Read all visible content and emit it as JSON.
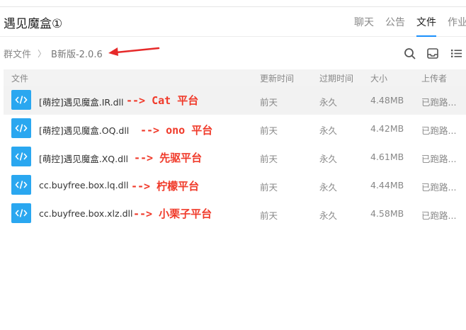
{
  "header": {
    "group_title": "遇见魔盒①",
    "tabs": [
      {
        "label": "聊天"
      },
      {
        "label": "公告"
      },
      {
        "label": "文件",
        "active": true
      },
      {
        "label": "作业"
      }
    ]
  },
  "breadcrumb": {
    "root": "群文件",
    "current": "B新版-2.0.6"
  },
  "toolbar": {
    "icons": [
      "search-icon",
      "inbox-icon",
      "list-view-icon"
    ]
  },
  "table": {
    "columns": {
      "name": "文件",
      "updated": "更新时间",
      "expire": "过期时间",
      "size": "大小",
      "uploader": "上传者"
    },
    "rows": [
      {
        "name": "[萌控]遇见魔盒.IR.dll",
        "note": "--> Cat 平台",
        "updated": "前天",
        "expire": "永久",
        "size": "4.48MB",
        "uploader": "已跑路..."
      },
      {
        "name": "[萌控]遇见魔盒.OQ.dll",
        "note": "--> ono 平台",
        "updated": "前天",
        "expire": "永久",
        "size": "4.42MB",
        "uploader": "已跑路..."
      },
      {
        "name": "[萌控]遇见魔盒.XQ.dll",
        "note": "--> 先驱平台",
        "updated": "前天",
        "expire": "永久",
        "size": "4.61MB",
        "uploader": "已跑路..."
      },
      {
        "name": "cc.buyfree.box.lq.dll",
        "note": "--> 柠檬平台",
        "updated": "前天",
        "expire": "永久",
        "size": "4.44MB",
        "uploader": "已跑路..."
      },
      {
        "name": "cc.buyfree.box.xlz.dll",
        "note": "--> 小栗子平台",
        "updated": "前天",
        "expire": "永久",
        "size": "4.58MB",
        "uploader": "已跑路..."
      }
    ]
  },
  "colors": {
    "accent": "#1a8ffb",
    "file_icon": "#2aa7f0",
    "annotation": "#f03a2a"
  }
}
